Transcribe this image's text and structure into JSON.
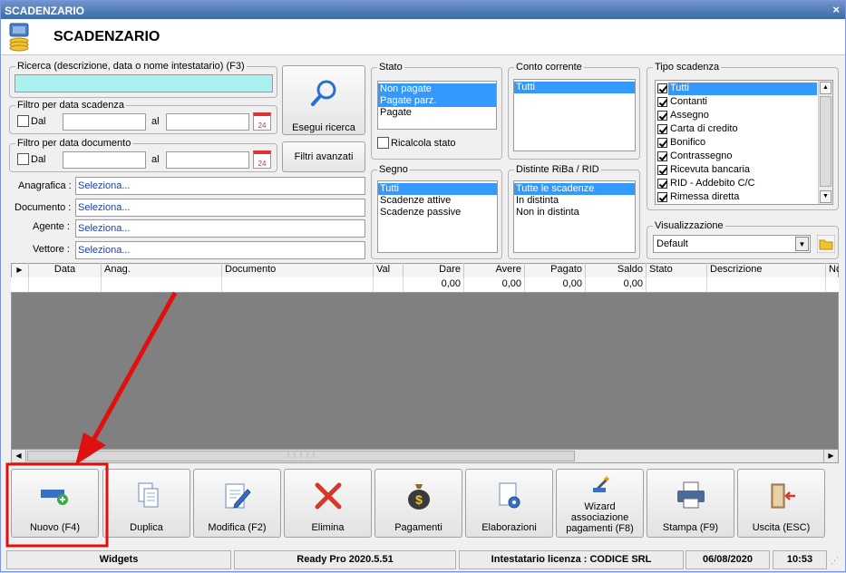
{
  "window": {
    "title": "SCADENZARIO",
    "close": "×"
  },
  "header": {
    "title": "SCADENZARIO"
  },
  "search": {
    "label": "Ricerca (descrizione, data o nome intestatario) (F3)",
    "value": "",
    "button": "Esegui ricerca"
  },
  "filter_due": {
    "label": "Filtro per data scadenza",
    "from": "Dal",
    "to": "al",
    "cal": "24"
  },
  "filter_doc": {
    "label": "Filtro per data documento",
    "from": "Dal",
    "to": "al",
    "cal": "24"
  },
  "advanced_filters": "Filtri avanzati",
  "fields": [
    {
      "label": "Anagrafica :",
      "value": "Seleziona..."
    },
    {
      "label": "Documento :",
      "value": "Seleziona..."
    },
    {
      "label": "Agente :",
      "value": "Seleziona..."
    },
    {
      "label": "Vettore :",
      "value": "Seleziona..."
    }
  ],
  "stato": {
    "label": "Stato",
    "items": [
      "Non pagate",
      "Pagate parz.",
      "Pagate"
    ],
    "recalc": "Ricalcola stato"
  },
  "conto": {
    "label": "Conto corrente",
    "items": [
      "Tutti"
    ]
  },
  "segno": {
    "label": "Segno",
    "items": [
      "Tutti",
      "Scadenze attive",
      "Scadenze passive"
    ]
  },
  "distinte": {
    "label": "Distinte RiBa / RID",
    "items": [
      "Tutte le scadenze",
      "In distinta",
      "Non in distinta"
    ]
  },
  "tipo": {
    "label": "Tipo scadenza",
    "items": [
      "Tutti",
      "Contanti",
      "Assegno",
      "Carta di credito",
      "Bonifico",
      "Contrassegno",
      "Ricevuta bancaria",
      "RID - Addebito C/C",
      "Rimessa diretta"
    ]
  },
  "view": {
    "label": "Visualizzazione",
    "value": "Default"
  },
  "grid": {
    "columns": [
      "Data",
      "Anag.",
      "Documento",
      "Val",
      "Dare",
      "Avere",
      "Pagato",
      "Saldo",
      "Stato",
      "Descrizione",
      "No"
    ],
    "totals": {
      "dare": "0,00",
      "avere": "0,00",
      "pagato": "0,00",
      "saldo": "0,00"
    }
  },
  "toolbar": [
    {
      "id": "nuovo",
      "label": "Nuovo (F4)",
      "icon": "new-record-icon"
    },
    {
      "id": "duplica",
      "label": "Duplica",
      "icon": "copy-icon"
    },
    {
      "id": "modifica",
      "label": "Modifica (F2)",
      "icon": "edit-icon"
    },
    {
      "id": "elimina",
      "label": "Elimina",
      "icon": "delete-icon"
    },
    {
      "id": "pagamenti",
      "label": "Pagamenti",
      "icon": "money-bag-icon"
    },
    {
      "id": "elaborazioni",
      "label": "Elaborazioni",
      "icon": "process-icon"
    },
    {
      "id": "wizard",
      "label": "Wizard associazione pagamenti (F8)",
      "icon": "wizard-icon"
    },
    {
      "id": "stampa",
      "label": "Stampa (F9)",
      "icon": "printer-icon"
    },
    {
      "id": "uscita",
      "label": "Uscita (ESC)",
      "icon": "exit-icon"
    }
  ],
  "status": {
    "widgets": "Widgets",
    "version": "Ready Pro 2020.5.51",
    "license": "Intestatario licenza : CODICE SRL",
    "date": "06/08/2020",
    "time": "10:53"
  },
  "colors": {
    "title_bar": "#3a6aa8",
    "selection": "#3399ff",
    "search_bg": "#aaf0ee",
    "grid_empty": "#808080",
    "highlight": "#e01010"
  }
}
